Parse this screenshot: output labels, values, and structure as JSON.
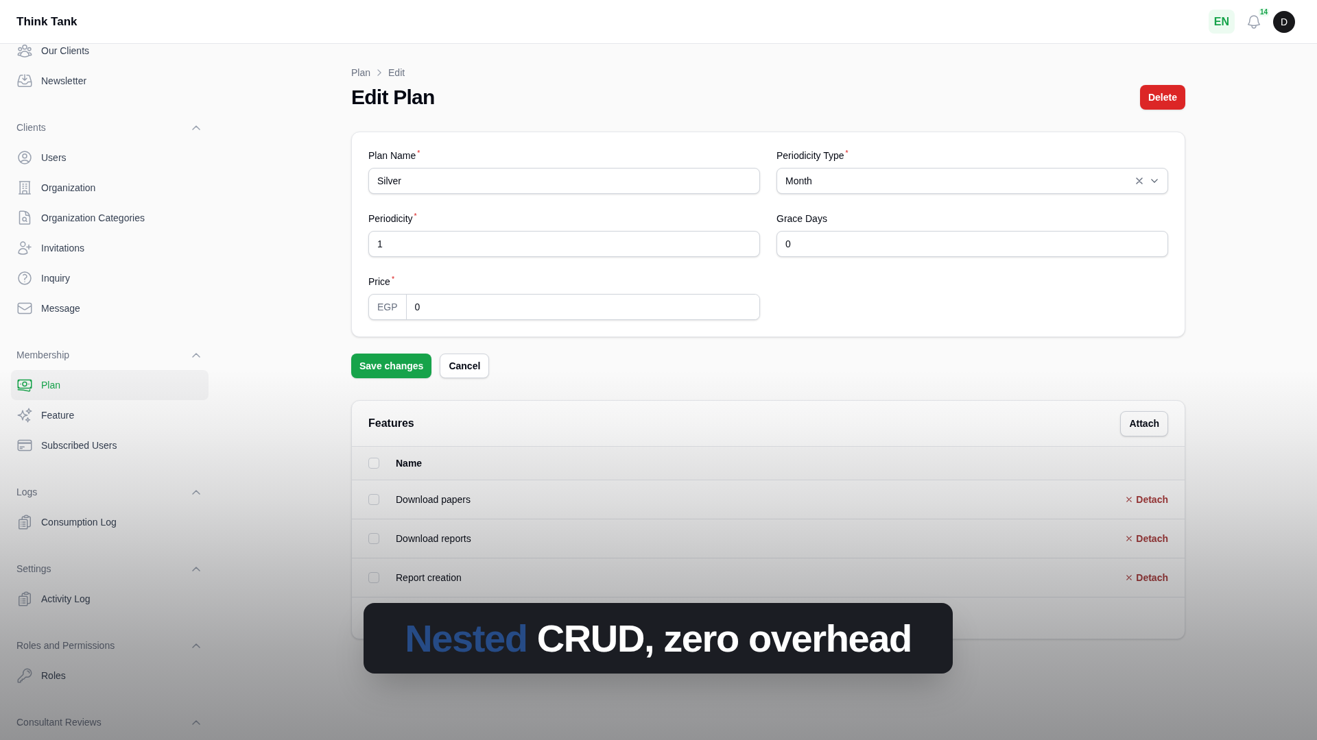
{
  "header": {
    "brand": "Think Tank",
    "language": "EN",
    "notification_count": "14",
    "avatar_initial": "D"
  },
  "sidebar": {
    "sections": [
      {
        "items": [
          {
            "label": "Our Clients",
            "selected": false
          },
          {
            "label": "Newsletter",
            "selected": false
          }
        ]
      },
      {
        "label": "Clients",
        "expanded": true,
        "items": [
          {
            "label": "Users",
            "selected": false
          },
          {
            "label": "Organization",
            "selected": false
          },
          {
            "label": "Organization Categories",
            "selected": false
          },
          {
            "label": "Invitations",
            "selected": false
          },
          {
            "label": "Inquiry",
            "selected": false
          },
          {
            "label": "Message",
            "selected": false
          }
        ]
      },
      {
        "label": "Membership",
        "expanded": true,
        "items": [
          {
            "label": "Plan",
            "selected": true
          },
          {
            "label": "Feature",
            "selected": false
          },
          {
            "label": "Subscribed Users",
            "selected": false
          }
        ]
      },
      {
        "label": "Logs",
        "expanded": true,
        "items": [
          {
            "label": "Consumption Log",
            "selected": false
          }
        ]
      },
      {
        "label": "Settings",
        "expanded": true,
        "items": [
          {
            "label": "Activity Log",
            "selected": false
          }
        ]
      },
      {
        "label": "Roles and Permissions",
        "expanded": true,
        "items": [
          {
            "label": "Roles",
            "selected": false
          }
        ]
      },
      {
        "label": "Consultant Reviews",
        "expanded": true
      }
    ]
  },
  "page": {
    "breadcrumbs": [
      "Plan",
      "Edit"
    ],
    "title": "Edit Plan",
    "delete_button": "Delete"
  },
  "form": {
    "fields": [
      {
        "kind": "text",
        "label": "Plan Name$^{*}$",
        "value": "Silver"
      },
      {
        "kind": "select",
        "label": "Periodicity Type$^{*}$",
        "value": "Month"
      },
      {
        "kind": "text",
        "label": "Periodicity$^{*}$",
        "value": "1"
      },
      {
        "kind": "text",
        "label": "Grace Days",
        "value": "0"
      },
      {
        "kind": "prefixed",
        "label": "Price$^{*}$",
        "prefix": "EGP",
        "value": "0"
      }
    ]
  },
  "form_actions": [
    {
      "kind": "primary",
      "label": "Save changes"
    },
    {
      "kind": "secondary",
      "label": "Cancel"
    }
  ],
  "features": {
    "title": "Features",
    "attach_button": "Attach",
    "select_all_checked": false,
    "columns": [
      "Name"
    ],
    "rows": [
      {
        "name": "Download papers",
        "checked": false,
        "action": "Detach"
      },
      {
        "name": "Download reports",
        "checked": false,
        "action": "Detach"
      },
      {
        "name": "Report creation",
        "checked": false,
        "action": "Detach"
      }
    ]
  },
  "caption": {
    "parts": [
      {
        "text": "Nested",
        "highlight": true
      },
      {
        "text": "CRUD, zero overhead",
        "highlight": false
      }
    ]
  }
}
